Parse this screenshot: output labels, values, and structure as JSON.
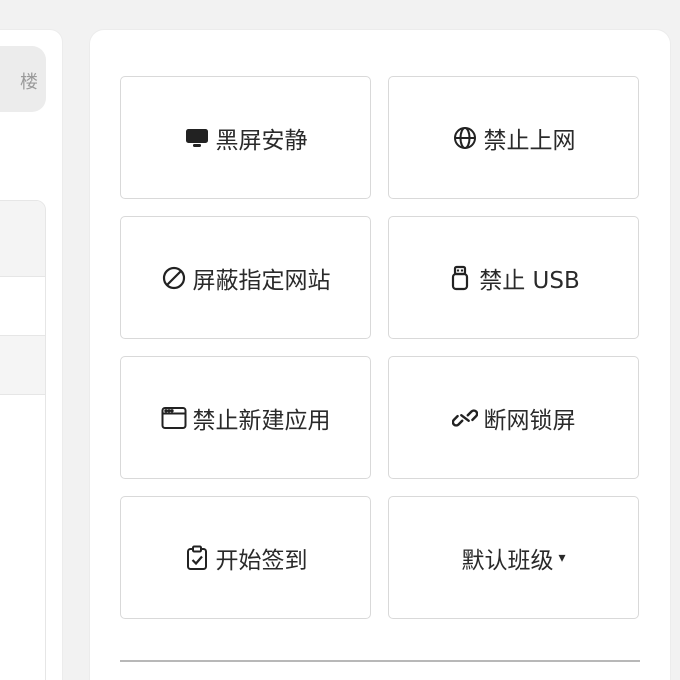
{
  "left_panel": {
    "tab_fragment": "楼"
  },
  "actions": [
    {
      "label": "黑屏安静",
      "icon": "monitor-icon"
    },
    {
      "label": "禁止上网",
      "icon": "globe-icon"
    },
    {
      "label": "屏蔽指定网站",
      "icon": "ban-icon"
    },
    {
      "label": "禁止 USB",
      "icon": "usb-icon"
    },
    {
      "label": "禁止新建应用",
      "icon": "window-icon"
    },
    {
      "label": "断网锁屏",
      "icon": "broken-link-icon"
    },
    {
      "label": "开始签到",
      "icon": "clipboard-check-icon"
    },
    {
      "label": "默认班级",
      "icon": null,
      "dropdown_caret": "▾"
    }
  ]
}
